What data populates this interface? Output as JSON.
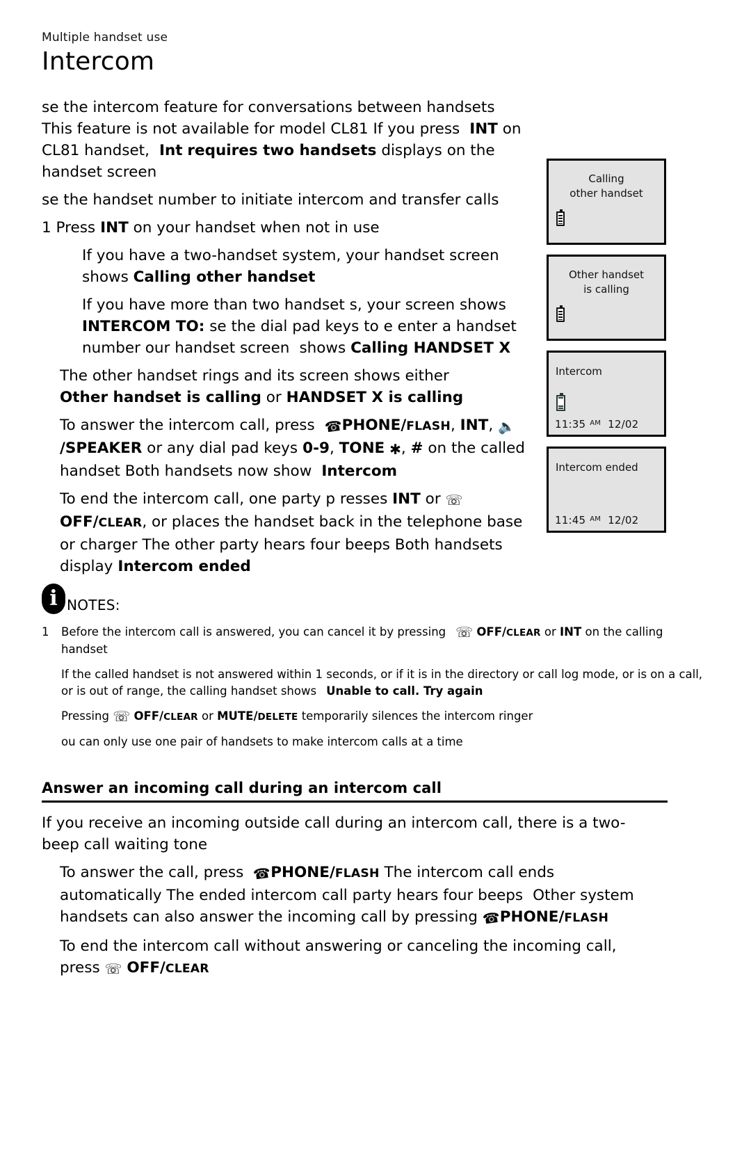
{
  "header": {
    "eyebrow": "Multiple handset use",
    "title": "Intercom"
  },
  "intro": {
    "line1_a": "se the intercom feature for conversations between handsets",
    "line1_b": "This feature is",
    "line2_a": "not available for model CL81 If you press",
    "line2_int": "INT",
    "line2_b": "on CL81 handset,",
    "line2_c": "Int",
    "line3_bold": "requires two handsets",
    "line3_rest": "displays on the  handset screen",
    "line4": "se the handset number to initiate intercom and transfer calls"
  },
  "steps": {
    "step1_num": "1",
    "step1_a": "Press",
    "step1_key": "INT",
    "step1_b": "on your handset when not in use",
    "sub1_a": "If you have a  two-handset system, your   handset screen",
    "sub1_b": "shows",
    "sub1_bold": "Calling other handset",
    "sub2_a": "If you have more than   two handset s, your screen shows",
    "sub2_bold": "INTERCOM TO:",
    "sub2_b": "se the dial pad keys to e   enter a handset",
    "sub2_c": "number our handset screen",
    "sub2_d": "shows",
    "sub2_bold2": "Calling HANDSET X",
    "step2": "The other handset rings and its screen shows either",
    "step2_bold1": "Other handset is calling",
    "step2_or": "or",
    "step2_bold2": "HANDSET X is calling",
    "answer_a": "To answer the intercom call, press",
    "answer_phone": "PHONE/",
    "answer_phone_sc": "FLASH",
    "answer_int": "INT",
    "answer_speaker": "/SPEAKER",
    "answer_b": "or any dial pad keys",
    "answer_keys": "0-9",
    "answer_tone": "TONE",
    "answer_hash": "#",
    "answer_c": "on the",
    "answer_d": "called handset Both handsets now show",
    "answer_bold": "Intercom",
    "end_a": "To end the intercom call, one party p   resses",
    "end_int": "INT",
    "end_or": "or",
    "end_off": "OFF/",
    "end_off_sc": "CLEAR",
    "end_b": ", or places the  handset back in the telephone",
    "end_c": "base or charger  The other party hears four beeps Both",
    "end_d": "handsets display",
    "end_bold": "Intercom ended"
  },
  "screens": [
    {
      "name": "calling-other-handset",
      "line1": "Calling",
      "line2": "other handset",
      "align": "center",
      "battery": "full",
      "time": null,
      "ampm": null,
      "date": null
    },
    {
      "name": "other-handset-is-calling",
      "line1": "Other handset",
      "line2": "is calling",
      "align": "center",
      "battery": "full",
      "time": null,
      "ampm": null,
      "date": null
    },
    {
      "name": "intercom",
      "line1": "Intercom",
      "line2": "",
      "align": "left",
      "battery": "low",
      "time": "11:35",
      "ampm": "AM",
      "date": "12/02"
    },
    {
      "name": "intercom-ended",
      "line1": "Intercom ended",
      "line2": "",
      "align": "left",
      "battery": "none",
      "time": "11:45",
      "ampm": "AM",
      "date": "12/02"
    }
  ],
  "notes": {
    "label": "NOTES:",
    "icon": "info-icon",
    "items": [
      {
        "num": "1",
        "a": "Before the intercom call is answered, you can cancel it by pressing",
        "off": "OFF/",
        "off_sc": "CLEAR",
        "or": "or",
        "int": "INT",
        "b": "on the",
        "c": "calling handset"
      },
      {
        "num": "",
        "a": "If the called handset is not answered within 1 seconds, or if it is in the directory or call log",
        "b": "mode, or is on a call, or is out of range, the calling handset shows",
        "bold": "Unable to call. Try again"
      },
      {
        "num": "",
        "a": "Pressing",
        "off": "OFF/",
        "off_sc": "CLEAR",
        "or": "or",
        "mute": "MUTE/",
        "mute_sc": "DELETE",
        "b": "temporarily silences the intercom ringer"
      },
      {
        "num": "",
        "a": "ou can only use one pair of handsets to make intercom calls at a time"
      }
    ]
  },
  "section": {
    "heading": "Answer an incoming call during an intercom call",
    "intro_a": "If you receive an incoming outside call during an intercom call, there is a",
    "intro_b": "two-beep call waiting tone",
    "b1_a": "To answer the call, press",
    "b1_phone": "PHONE/",
    "b1_phone_sc": "FLASH",
    "b1_b": "The intercom call ends",
    "b1_c": "automatically The ended intercom call party hears four beeps",
    "b1_d": "Other system",
    "b1_e": "handsets can  also answer the incoming call by pressing",
    "b1_phone2": "PHONE/",
    "b1_phone2_sc": "FLASH",
    "b2_a": "To end the intercom call without   answering or canceling  the incoming call,",
    "b2_b": "press",
    "b2_off": "OFF/",
    "b2_off_sc": "CLEAR"
  },
  "colors": {
    "text": "#000000",
    "screen_bg": "#e3e3e3",
    "screen_border": "#000000",
    "page_bg": "#ffffff"
  }
}
